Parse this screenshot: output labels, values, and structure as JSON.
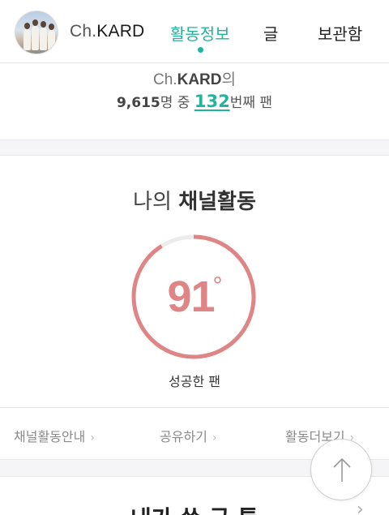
{
  "header": {
    "channel_ch": "Ch.",
    "channel_kard": "KARD",
    "tabs": [
      {
        "label": "활동정보",
        "active": true
      },
      {
        "label": "글",
        "active": false
      },
      {
        "label": "보관함",
        "active": false
      }
    ],
    "avatar_icon": "group-photo-avatar"
  },
  "rank": {
    "channel_prefix": "Ch.",
    "channel_name": "KARD",
    "channel_suffix": "의",
    "total_fans": "9,615",
    "total_suffix": "명 중",
    "my_rank": "132",
    "rank_suffix": "번째 팬"
  },
  "activity": {
    "title_prefix": "나의",
    "title_bold": "채널활동",
    "temperature": "91",
    "degree_symbol": "°",
    "temperature_fraction": 0.91,
    "grade": "성공한 팬",
    "gauge_color": "#e08585",
    "track_color": "#ececec"
  },
  "links": [
    {
      "label": "채널활동안내",
      "chevron": "›"
    },
    {
      "label": "공유하기",
      "chevron": "›"
    },
    {
      "label": "활동더보기",
      "chevron": "›"
    }
  ],
  "next_section": {
    "title": "내가 쓴 글 톡",
    "chevron": "›"
  },
  "top_button": {
    "icon": "arrow-up-icon"
  },
  "colors": {
    "accent": "#22b59b",
    "gauge": "#e08585"
  }
}
